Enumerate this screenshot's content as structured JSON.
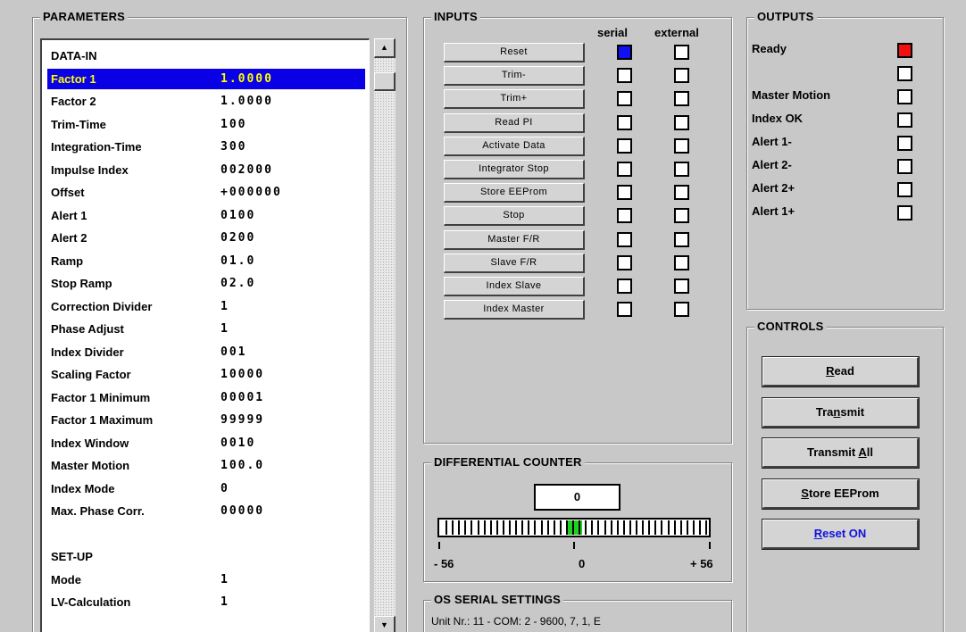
{
  "parameters": {
    "title": "PARAMETERS",
    "rows": [
      {
        "name": "DATA-IN",
        "value": ""
      },
      {
        "name": "Factor 1",
        "value": "1.0000"
      },
      {
        "name": "Factor 2",
        "value": "1.0000"
      },
      {
        "name": "Trim-Time",
        "value": "100"
      },
      {
        "name": "Integration-Time",
        "value": "300"
      },
      {
        "name": "Impulse Index",
        "value": "002000"
      },
      {
        "name": "Offset",
        "value": "+000000"
      },
      {
        "name": "Alert 1",
        "value": "0100"
      },
      {
        "name": "Alert 2",
        "value": "0200"
      },
      {
        "name": "Ramp",
        "value": "01.0"
      },
      {
        "name": "Stop Ramp",
        "value": "02.0"
      },
      {
        "name": "Correction Divider",
        "value": "1"
      },
      {
        "name": "Phase Adjust",
        "value": "1"
      },
      {
        "name": "Index Divider",
        "value": "001"
      },
      {
        "name": "Scaling Factor",
        "value": "10000"
      },
      {
        "name": "Factor 1 Minimum",
        "value": "00001"
      },
      {
        "name": "Factor 1 Maximum",
        "value": "99999"
      },
      {
        "name": "Index Window",
        "value": "0010"
      },
      {
        "name": "Master Motion",
        "value": "100.0"
      },
      {
        "name": "Index Mode",
        "value": "0"
      },
      {
        "name": "Max. Phase Corr.",
        "value": "00000"
      },
      {
        "name": "",
        "value": ""
      },
      {
        "name": "SET-UP",
        "value": ""
      },
      {
        "name": "Mode",
        "value": "1"
      },
      {
        "name": "LV-Calculation",
        "value": "1"
      }
    ],
    "selected_index": 1,
    "scroll_up_icon": "arrow-up-icon",
    "scroll_down_icon": "arrow-down-icon"
  },
  "inputs": {
    "title": "INPUTS",
    "col_serial": "serial",
    "col_external": "external",
    "buttons": [
      {
        "label": "Reset",
        "serial": true,
        "external": false
      },
      {
        "label": "Trim-",
        "serial": false,
        "external": false
      },
      {
        "label": "Trim+",
        "serial": false,
        "external": false
      },
      {
        "label": "Read PI",
        "serial": false,
        "external": false
      },
      {
        "label": "Activate Data",
        "serial": false,
        "external": false
      },
      {
        "label": "Integrator Stop",
        "serial": false,
        "external": false
      },
      {
        "label": "Store EEProm",
        "serial": false,
        "external": false
      },
      {
        "label": "Stop",
        "serial": false,
        "external": false
      },
      {
        "label": "Master F/R",
        "serial": false,
        "external": false
      },
      {
        "label": "Slave  F/R",
        "serial": false,
        "external": false
      },
      {
        "label": "Index Slave",
        "serial": false,
        "external": false
      },
      {
        "label": "Index Master",
        "serial": false,
        "external": false
      }
    ]
  },
  "outputs": {
    "title": "OUTPUTS",
    "items": [
      {
        "label": "Ready",
        "active": true
      },
      {
        "label": "",
        "active": false
      },
      {
        "label": "Master Motion",
        "active": false
      },
      {
        "label": "Index OK",
        "active": false
      },
      {
        "label": "Alert 1-",
        "active": false
      },
      {
        "label": "Alert 2-",
        "active": false
      },
      {
        "label": "Alert 2+",
        "active": false
      },
      {
        "label": "Alert 1+",
        "active": false
      }
    ],
    "active_color": "#f01010"
  },
  "controls": {
    "title": "CONTROLS",
    "buttons": [
      {
        "pre": "",
        "key": "R",
        "post": "ead",
        "blue": false
      },
      {
        "pre": "Tra",
        "key": "n",
        "post": "smit",
        "blue": false
      },
      {
        "pre": "Transmit ",
        "key": "A",
        "post": "ll",
        "blue": false
      },
      {
        "pre": "",
        "key": "S",
        "post": "tore EEProm",
        "blue": false
      },
      {
        "pre": "",
        "key": "R",
        "post": "eset ON",
        "blue": true
      }
    ]
  },
  "differential_counter": {
    "title": "DIFFERENTIAL COUNTER",
    "value": "0",
    "min_label": "- 56",
    "mid_label": "0",
    "max_label": "+ 56",
    "min": -56,
    "max": 56,
    "current": 0,
    "indicator_color": "#20d020"
  },
  "serial_settings": {
    "title": "OS SERIAL SETTINGS",
    "text": "Unit Nr.: 11  -  COM:  2  -  9600, 7, 1, E"
  },
  "colors": {
    "background": "#c8c8c8",
    "selection": "#0a00e6",
    "selection_text": "#ffff00",
    "serial_active": "#1010f0"
  }
}
